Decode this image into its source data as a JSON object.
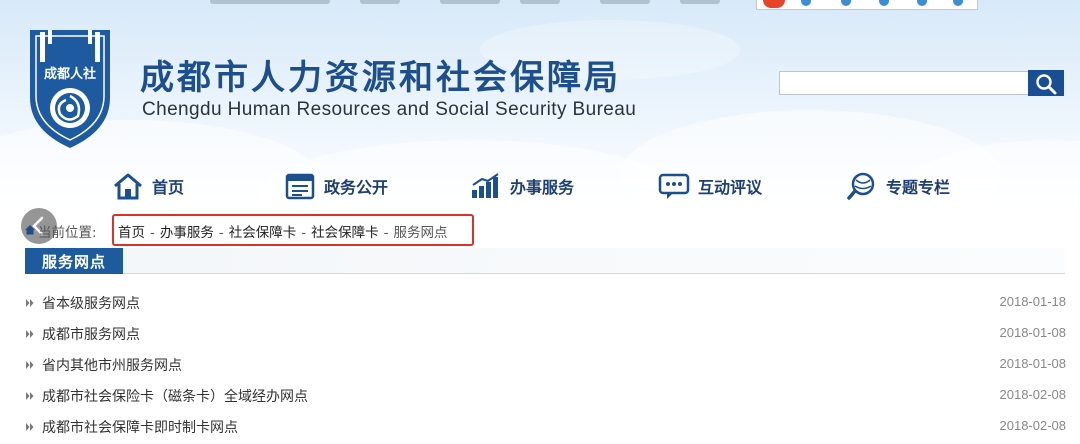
{
  "header": {
    "title_cn": "成都市人力资源和社会保障局",
    "title_en": "Chengdu Human Resources and Social Security Bureau",
    "logo_text": "成都人社",
    "search": {
      "value": "",
      "placeholder": ""
    }
  },
  "nav": [
    {
      "label": "首页",
      "icon": "home-icon"
    },
    {
      "label": "政务公开",
      "icon": "document-icon"
    },
    {
      "label": "办事服务",
      "icon": "bar-chart-icon"
    },
    {
      "label": "互动评议",
      "icon": "chat-icon"
    },
    {
      "label": "专题专栏",
      "icon": "magnifier-globe-icon"
    }
  ],
  "breadcrumb": {
    "label": "当前位置:",
    "items": [
      "首页",
      "办事服务",
      "社会保障卡",
      "社会保障卡",
      "服务网点"
    ],
    "separator": "-"
  },
  "section": {
    "title": "服务网点"
  },
  "list": [
    {
      "title": "省本级服务网点",
      "date": "2018-01-18"
    },
    {
      "title": "成都市服务网点",
      "date": "2018-01-08"
    },
    {
      "title": "省内其他市州服务网点",
      "date": "2018-01-08"
    },
    {
      "title": "成都市社会保险卡（磁条卡）全域经办网点",
      "date": "2018-02-08"
    },
    {
      "title": "成都市社会保障卡即时制卡网点",
      "date": "2018-02-08"
    }
  ],
  "colors": {
    "brand_blue": "#1d4f8d",
    "tab_blue": "#1e5b9c",
    "highlight_red": "#d8322a"
  }
}
